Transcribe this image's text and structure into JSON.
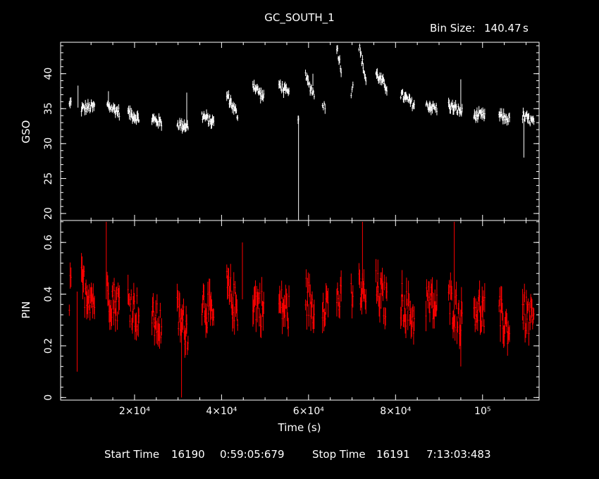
{
  "title": "GC_SOUTH_1",
  "bin_size_label": "Bin Size:",
  "bin_size_value": "140.47",
  "bin_size_unit": "s",
  "footer": {
    "start_label": "Start Time",
    "start_day": "16190",
    "start_time": "0:59:05:679",
    "stop_label": "Stop Time",
    "stop_day": "16191",
    "stop_time": "7:13:03:483"
  },
  "chart_data": [
    {
      "type": "scatter",
      "panel": "top",
      "xlabel": "Time (s)",
      "ylabel": "GSO",
      "xlim": [
        3000,
        113000
      ],
      "ylim": [
        19,
        44.5
      ],
      "yticks": [
        20,
        25,
        30,
        35,
        40
      ],
      "xticks": [
        20000,
        40000,
        60000,
        80000,
        100000
      ],
      "xtick_labels": [
        "2×10⁴",
        "4×10⁴",
        "6×10⁴",
        "8×10⁴",
        "10⁵"
      ],
      "color": "#ffffff",
      "grid": false,
      "segments": [
        {
          "x": [
            5000,
            5400
          ],
          "y": [
            35.5,
            35.8
          ]
        },
        {
          "x": [
            7800,
            10800
          ],
          "y": [
            35.0,
            35.3
          ]
        },
        {
          "x": [
            13700,
            16500
          ],
          "y": [
            35.5,
            34.5
          ]
        },
        {
          "x": [
            18500,
            21000
          ],
          "y": [
            34.5,
            33.5
          ]
        },
        {
          "x": [
            24000,
            26200
          ],
          "y": [
            33.5,
            33.0
          ]
        },
        {
          "x": [
            29800,
            32300
          ],
          "y": [
            32.8,
            32.5
          ]
        },
        {
          "x": [
            35500,
            38200
          ],
          "y": [
            34.0,
            33.0
          ]
        },
        {
          "x": [
            41200,
            43700
          ],
          "y": [
            37.0,
            34.0
          ]
        },
        {
          "x": [
            47200,
            49700
          ],
          "y": [
            38.5,
            36.5
          ]
        },
        {
          "x": [
            53200,
            55500
          ],
          "y": [
            38.5,
            37.0
          ]
        },
        {
          "x": [
            57600,
            57700
          ],
          "y": [
            34.0,
            34.0
          ]
        },
        {
          "x": [
            59300,
            61300
          ],
          "y": [
            39.5,
            37.0
          ]
        },
        {
          "x": [
            63200,
            63800
          ],
          "y": [
            36.0,
            35.0
          ]
        },
        {
          "x": [
            66500,
            67500
          ],
          "y": [
            44.0,
            40.5
          ]
        },
        {
          "x": [
            69800,
            70200
          ],
          "y": [
            37.5,
            38.5
          ]
        },
        {
          "x": [
            71600,
            73200
          ],
          "y": [
            44.0,
            39.0
          ]
        },
        {
          "x": [
            75500,
            78000
          ],
          "y": [
            40.0,
            38.0
          ]
        },
        {
          "x": [
            81200,
            84300
          ],
          "y": [
            37.0,
            35.5
          ]
        },
        {
          "x": [
            87000,
            89500
          ],
          "y": [
            35.5,
            35.0
          ]
        },
        {
          "x": [
            92200,
            95300
          ],
          "y": [
            35.5,
            34.5
          ]
        },
        {
          "x": [
            98000,
            100500
          ],
          "y": [
            34.0,
            34.0
          ]
        },
        {
          "x": [
            103800,
            106200
          ],
          "y": [
            34.0,
            33.5
          ]
        },
        {
          "x": [
            109200,
            111800
          ],
          "y": [
            34.0,
            33.0
          ]
        }
      ],
      "spikes": [
        {
          "x": 7000,
          "y": 38.3
        },
        {
          "x": 14000,
          "y": 37.5
        },
        {
          "x": 32000,
          "y": 37.3
        },
        {
          "x": 57700,
          "y": 19.0
        },
        {
          "x": 61000,
          "y": 40.0
        },
        {
          "x": 95000,
          "y": 39.2
        },
        {
          "x": 109500,
          "y": 28.0
        }
      ]
    },
    {
      "type": "scatter",
      "panel": "bottom",
      "xlabel": "Time (s)",
      "ylabel": "PIN",
      "xlim": [
        3000,
        113000
      ],
      "ylim": [
        -0.01,
        0.685
      ],
      "yticks": [
        0,
        0.2,
        0.4,
        0.6
      ],
      "ytick_labels": [
        "0",
        "0.2",
        "0.4",
        "0.6"
      ],
      "xticks": [
        20000,
        40000,
        60000,
        80000,
        100000
      ],
      "xtick_labels": [
        "2×10⁴",
        "4×10⁴",
        "6×10⁴",
        "8×10⁴",
        "10⁵"
      ],
      "color": "#ff0000",
      "grid": false,
      "segments": [
        {
          "x": [
            5000,
            5400
          ],
          "y": [
            0.38,
            0.42
          ]
        },
        {
          "x": [
            7800,
            10800
          ],
          "y": [
            0.44,
            0.38
          ]
        },
        {
          "x": [
            13700,
            16500
          ],
          "y": [
            0.4,
            0.36
          ]
        },
        {
          "x": [
            18500,
            21000
          ],
          "y": [
            0.38,
            0.32
          ]
        },
        {
          "x": [
            24000,
            26200
          ],
          "y": [
            0.3,
            0.28
          ]
        },
        {
          "x": [
            29800,
            32300
          ],
          "y": [
            0.32,
            0.26
          ]
        },
        {
          "x": [
            35500,
            38200
          ],
          "y": [
            0.38,
            0.3
          ]
        },
        {
          "x": [
            41200,
            43700
          ],
          "y": [
            0.42,
            0.34
          ]
        },
        {
          "x": [
            47200,
            49700
          ],
          "y": [
            0.38,
            0.34
          ]
        },
        {
          "x": [
            53200,
            55500
          ],
          "y": [
            0.36,
            0.33
          ]
        },
        {
          "x": [
            59300,
            61300
          ],
          "y": [
            0.4,
            0.34
          ]
        },
        {
          "x": [
            63200,
            64500
          ],
          "y": [
            0.38,
            0.36
          ]
        },
        {
          "x": [
            66500,
            67500
          ],
          "y": [
            0.4,
            0.36
          ]
        },
        {
          "x": [
            69800,
            70200
          ],
          "y": [
            0.38,
            0.4
          ]
        },
        {
          "x": [
            71600,
            73200
          ],
          "y": [
            0.42,
            0.38
          ]
        },
        {
          "x": [
            75500,
            78000
          ],
          "y": [
            0.42,
            0.36
          ]
        },
        {
          "x": [
            81200,
            84300
          ],
          "y": [
            0.38,
            0.3
          ]
        },
        {
          "x": [
            87000,
            89500
          ],
          "y": [
            0.38,
            0.34
          ]
        },
        {
          "x": [
            92200,
            95300
          ],
          "y": [
            0.38,
            0.3
          ]
        },
        {
          "x": [
            98000,
            100500
          ],
          "y": [
            0.36,
            0.32
          ]
        },
        {
          "x": [
            103800,
            106200
          ],
          "y": [
            0.32,
            0.26
          ]
        },
        {
          "x": [
            109200,
            111800
          ],
          "y": [
            0.34,
            0.28
          ]
        }
      ],
      "spikes": [
        {
          "x": 6800,
          "y": 0.1
        },
        {
          "x": 13500,
          "y": 0.68
        },
        {
          "x": 30800,
          "y": 0.0
        },
        {
          "x": 44800,
          "y": 0.6
        },
        {
          "x": 72400,
          "y": 0.68
        },
        {
          "x": 93500,
          "y": 0.68
        },
        {
          "x": 95000,
          "y": 0.12
        }
      ]
    }
  ]
}
